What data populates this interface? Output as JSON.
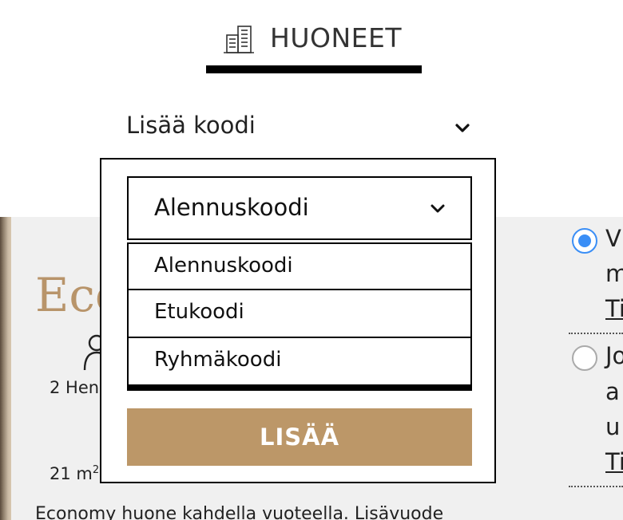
{
  "nav": {
    "rooms_label": "HUONEET",
    "icon": "building-icon"
  },
  "promo": {
    "toggle_label": "Lisää koodi",
    "icon": "chevron-down-icon"
  },
  "code_select": {
    "selected": "Alennuskoodi",
    "options": [
      "Alennuskoodi",
      "Etukoodi",
      "Ryhmäkoodi"
    ]
  },
  "add_button_label": "LISÄÄ",
  "room": {
    "title_partial": "Eco",
    "guests_partial": "2 Hen",
    "area_partial": "21 m",
    "area_unit_sup": "2",
    "description_partial": "Economy huone kahdella vuoteella. Lisävuode"
  },
  "rate_options": {
    "first": {
      "line1": "V",
      "line2": "m",
      "link": "Ti",
      "selected": true
    },
    "second": {
      "line1": "Jo",
      "line2": "a",
      "line3": "u",
      "link": "Ti",
      "selected": false
    }
  },
  "colors": {
    "accent": "#bc9768",
    "title": "#b8946a",
    "radio": "#3a8ef6",
    "content_bg": "#f0f0f0"
  }
}
